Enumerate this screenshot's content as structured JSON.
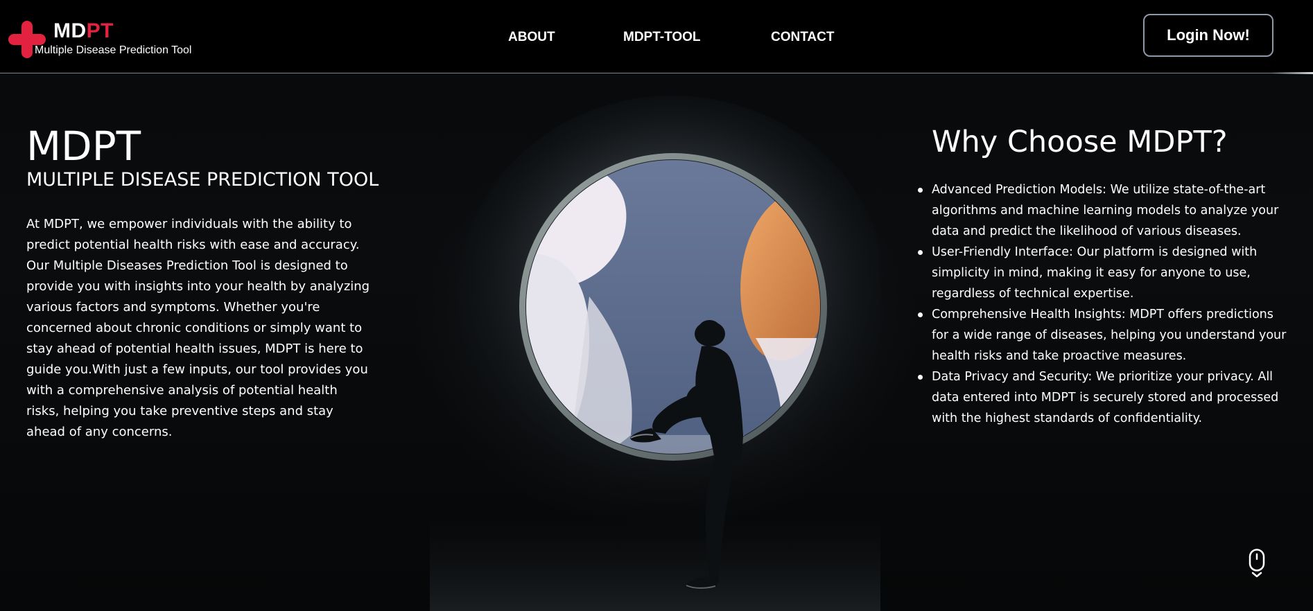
{
  "colors": {
    "brand_red": "#e3223f",
    "text": "#ffffff",
    "header_bg": "#000000",
    "button_border": "#8e9aaa"
  },
  "header": {
    "logo": {
      "name_part1": "MD",
      "name_part2": "PT",
      "tagline": "Multiple Disease Prediction Tool",
      "icon": "medical-cross-icon"
    },
    "nav": {
      "about": "ABOUT",
      "tool": "MDPT-TOOL",
      "contact": "CONTACT"
    },
    "login_label": "Login Now!"
  },
  "hero": {
    "title": "MDPT",
    "subtitle": "MULTIPLE DISEASE PREDICTION TOOL",
    "description": "At MDPT, we empower individuals with the ability to predict potential health risks with ease and accuracy. Our Multiple Diseases Prediction Tool is designed to provide you with insights into your health by analyzing various factors and symptoms. Whether you're concerned about chronic conditions or simply want to stay ahead of potential health issues, MDPT is here to guide you.With just a few inputs, our tool provides you with a comprehensive analysis of potential health risks, helping you take preventive steps and stay ahead of any concerns."
  },
  "why": {
    "title": "Why Choose MDPT?",
    "items": [
      "Advanced Prediction Models: We utilize state-of-the-art algorithms and machine learning models to analyze your data and predict the likelihood of various diseases.",
      "User-Friendly Interface: Our platform is designed with simplicity in mind, making it easy for anyone to use, regardless of technical expertise.",
      "Comprehensive Health Insights: MDPT offers predictions for a wide range of diseases, helping you understand your health risks and take proactive measures.",
      "Data Privacy and Security: We prioritize your privacy. All data entered into MDPT is securely stored and processed with the highest standards of confidentiality."
    ]
  },
  "scroll_indicator": {
    "icon": "mouse-scroll-icon"
  }
}
